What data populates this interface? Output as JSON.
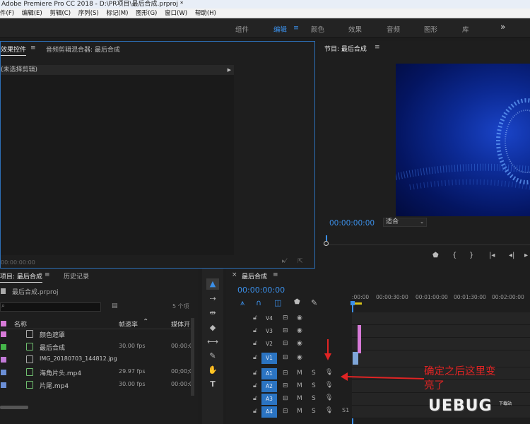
{
  "window": {
    "title": "Adobe Premiere Pro CC 2018 - D:\\PR项目\\最后合成.prproj *"
  },
  "menu": [
    "件(F)",
    "编辑(E)",
    "剪辑(C)",
    "序列(S)",
    "标记(M)",
    "图形(G)",
    "窗口(W)",
    "帮助(H)"
  ],
  "workspaces": [
    "组件",
    "编辑",
    "颜色",
    "效果",
    "音频",
    "图形",
    "库"
  ],
  "workspace_overflow": "»",
  "effects_panel": {
    "tab_effect_controls": "效果控件",
    "tab_audio_mixer": "音频剪辑混合器: 最后合成",
    "no_clip": "(未选择剪辑)",
    "timecode": "00:00:00:00"
  },
  "program_monitor": {
    "title": "节目: 最后合成",
    "timecode": "00:00:00:00",
    "fit": "适合"
  },
  "project_panel": {
    "tab_project": "项目: 最后合成",
    "tab_history": "历史记录",
    "file": "最后合成.prproj",
    "item_count": "5 个项",
    "col_name": "名称",
    "col_fps": "帧速率",
    "col_start": "媒体开",
    "items": [
      {
        "name": "颜色遮罩",
        "fps": "",
        "start": "",
        "color": "#d77ad8"
      },
      {
        "name": "最后合成",
        "fps": "30.00 fps",
        "start": "00:00:0",
        "color": "#45b64a"
      },
      {
        "name": "IMG_20180703_144812.jpg",
        "fps": "",
        "start": "",
        "color": "#c27ad8"
      },
      {
        "name": "海角片头.mp4",
        "fps": "29.97 fps",
        "start": "00;00;0",
        "color": "#6b8fd6"
      },
      {
        "name": "片尾.mp4",
        "fps": "30.00 fps",
        "start": "00:00:0",
        "color": "#6b8fd6"
      }
    ]
  },
  "timeline": {
    "tab": "最后合成",
    "timecode": "00:00:00:00",
    "ruler": [
      ":00:00",
      "00:00:30:00",
      "00:01:00:00",
      "00:01:30:00",
      "00:02:00:00"
    ],
    "video_tracks": [
      "V4",
      "V3",
      "V2",
      "V1"
    ],
    "audio_tracks": [
      "A1",
      "A2",
      "A3",
      "A4"
    ],
    "mute": "M",
    "solo": "S",
    "submix_label": "S1"
  },
  "annotation": {
    "line1": "确定之后这里变",
    "line2": "亮了"
  },
  "watermark": {
    "main": "UEBUG",
    "small": "下载站"
  }
}
